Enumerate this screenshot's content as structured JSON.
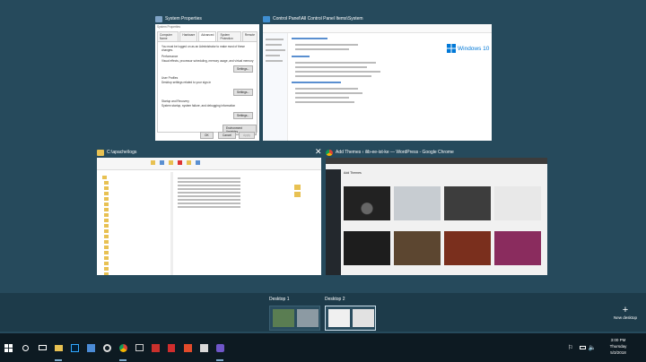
{
  "windows": {
    "system_properties": {
      "title": "System Properties",
      "dialog_caption": "System Properties",
      "tabs": [
        "Computer Name",
        "Hardware",
        "Advanced",
        "System Protection",
        "Remote"
      ],
      "admin_note": "You must be logged on as an Administrator to make most of these changes.",
      "performance_label": "Performance",
      "performance_desc": "Visual effects, processor scheduling, memory usage, and virtual memory",
      "user_profiles_label": "User Profiles",
      "user_profiles_desc": "Desktop settings related to your sign-in",
      "startup_label": "Startup and Recovery",
      "startup_desc": "System startup, system failure, and debugging information",
      "settings_label": "Settings...",
      "env_vars_label": "Environment Variables...",
      "ok_label": "OK",
      "cancel_label": "Cancel",
      "apply_label": "Apply"
    },
    "control_panel": {
      "title": "Control Panel\\All Control Panel Items\\System",
      "windows_logo_text": "Windows 10"
    },
    "explorer": {
      "title": "C:\\apache\\logs"
    },
    "chrome": {
      "title": "Add Themes ‹ ilib-ee-ist-ke — WordPress - Google Chrome",
      "page_heading": "Add Themes"
    }
  },
  "desktops": [
    {
      "label": "Desktop 1"
    },
    {
      "label": "Desktop 2"
    }
  ],
  "new_desktop_label": "New desktop",
  "clock": {
    "time": "3:00 PM",
    "day": "Thursday",
    "date": "5/3/2018"
  },
  "colors": {
    "accent": "#0078d7",
    "background": "#264a5c"
  }
}
